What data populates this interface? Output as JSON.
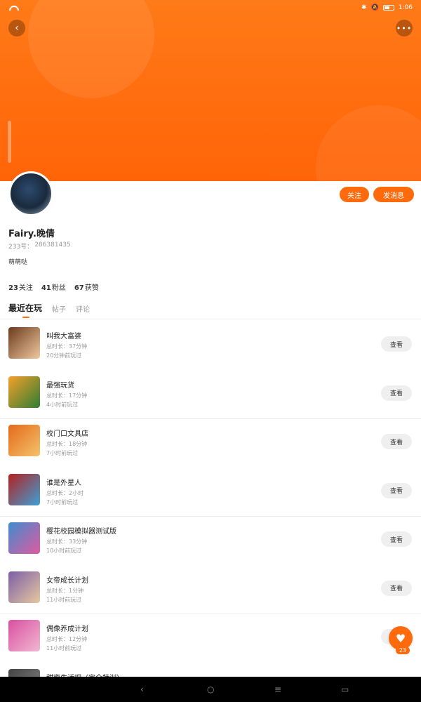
{
  "status": {
    "time": "1:06"
  },
  "header": {
    "back_icon": "back-icon",
    "more_icon": "more-icon"
  },
  "profile": {
    "name": "Fairy.晚倩",
    "id_label": "233号：",
    "id_value": "286381435",
    "bio": "萌萌哒",
    "follow_label": "关注",
    "message_label": "发消息",
    "stats": [
      {
        "value": "23",
        "label": "关注"
      },
      {
        "value": "41",
        "label": "粉丝"
      },
      {
        "value": "67",
        "label": "获赞"
      }
    ]
  },
  "tabs": [
    {
      "label": "最近在玩",
      "active": true
    },
    {
      "label": "帖子",
      "active": false
    },
    {
      "label": "评论",
      "active": false
    }
  ],
  "games": [
    {
      "name": "叫我大富婆",
      "duration": "总时长：37分钟",
      "last": "20分钟前玩过",
      "button": "查看",
      "thumb_colors": [
        "#6b3a1c",
        "#f0c9a0"
      ]
    },
    {
      "name": "最强玩货",
      "duration": "总时长：17分钟",
      "last": "4小时前玩过",
      "button": "查看",
      "thumb_colors": [
        "#f3a12b",
        "#2e7d32"
      ]
    },
    {
      "name": "校门口文具店",
      "duration": "总时长：18分钟",
      "last": "7小时前玩过",
      "button": "查看",
      "thumb_colors": [
        "#e36a1a",
        "#f5c26b"
      ]
    },
    {
      "name": "谁是外星人",
      "duration": "总时长：2小时",
      "last": "7小时前玩过",
      "button": "查看",
      "thumb_colors": [
        "#b3201f",
        "#3da1d6"
      ]
    },
    {
      "name": "樱花校园模拟器测试版",
      "duration": "总时长：33分钟",
      "last": "10小时前玩过",
      "button": "查看",
      "thumb_colors": [
        "#3f8ccf",
        "#e05aa0"
      ]
    },
    {
      "name": "女帝成长计划",
      "duration": "总时长：1分钟",
      "last": "11小时前玩过",
      "button": "查看",
      "thumb_colors": [
        "#7b5ea7",
        "#e8c8a0"
      ]
    },
    {
      "name": "偶像养成计划",
      "duration": "总时长：12分钟",
      "last": "11小时前玩过",
      "button": "查看",
      "thumb_colors": [
        "#d94fa0",
        "#f2b8d2"
      ]
    },
    {
      "name": "甜蜜生活吧（完全特训）",
      "duration": "",
      "last": "",
      "button": "",
      "thumb_colors": [
        "#444444",
        "#888888"
      ]
    }
  ],
  "like": {
    "count": "23"
  },
  "navbar": {
    "back": "‹",
    "home": "○",
    "menu": "≡",
    "recent": "▭"
  },
  "colors": {
    "accent": "#ff6a0d",
    "banner": "#ff7a18"
  }
}
